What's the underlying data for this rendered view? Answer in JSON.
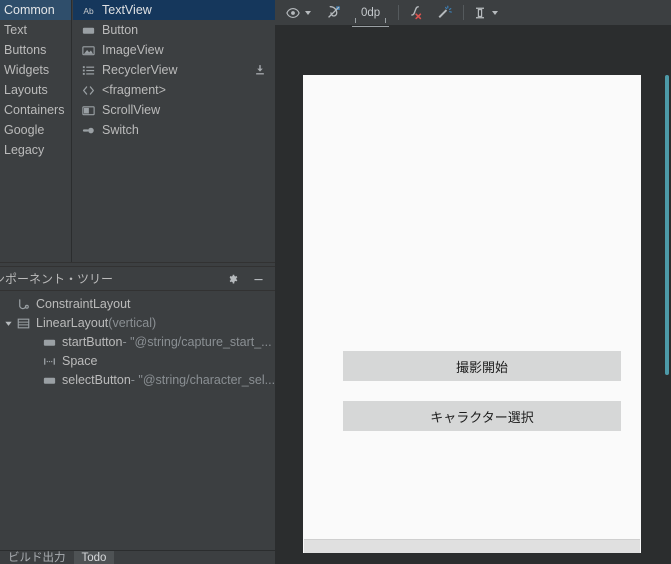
{
  "palette": {
    "categories": [
      {
        "label": "Common",
        "selected": true
      },
      {
        "label": "Text",
        "selected": false
      },
      {
        "label": "Buttons",
        "selected": false
      },
      {
        "label": "Widgets",
        "selected": false
      },
      {
        "label": "Layouts",
        "selected": false
      },
      {
        "label": "Containers",
        "selected": false
      },
      {
        "label": "Google",
        "selected": false
      },
      {
        "label": "Legacy",
        "selected": false
      }
    ],
    "items": [
      {
        "label": "TextView",
        "icon": "textview-icon",
        "selected": true,
        "download": false
      },
      {
        "label": "Button",
        "icon": "button-icon",
        "selected": false,
        "download": false
      },
      {
        "label": "ImageView",
        "icon": "imageview-icon",
        "selected": false,
        "download": false
      },
      {
        "label": "RecyclerView",
        "icon": "recyclerview-icon",
        "selected": false,
        "download": true
      },
      {
        "label": "<fragment>",
        "icon": "fragment-icon",
        "selected": false,
        "download": false
      },
      {
        "label": "ScrollView",
        "icon": "scrollview-icon",
        "selected": false,
        "download": false
      },
      {
        "label": "Switch",
        "icon": "switch-icon",
        "selected": false,
        "download": false
      }
    ]
  },
  "tree": {
    "title": "ンポーネント・ツリー",
    "settings_icon": "gear-icon",
    "minimize_icon": "minimize-icon",
    "rows": [
      {
        "indent": 0,
        "twisty": "",
        "icon": "constraintlayout-icon",
        "name": "ConstraintLayout",
        "suffix": ""
      },
      {
        "indent": 0,
        "twisty": "▼",
        "icon": "linearlayout-icon",
        "name": "LinearLayout",
        "suffix": "(vertical)"
      },
      {
        "indent": 1,
        "twisty": "",
        "icon": "button-icon",
        "name": "startButton",
        "suffix": "- \"@string/capture_start_..."
      },
      {
        "indent": 1,
        "twisty": "",
        "icon": "space-icon",
        "name": "Space",
        "suffix": ""
      },
      {
        "indent": 1,
        "twisty": "",
        "icon": "button-icon",
        "name": "selectButton",
        "suffix": "- \"@string/character_sel..."
      }
    ]
  },
  "bottom_tabs": [
    {
      "label": "ビルド出力",
      "active": false
    },
    {
      "label": "Todo",
      "active": true
    },
    {
      "label": "",
      "active": false
    }
  ],
  "toolbar": {
    "view_options_icon": "eye-icon",
    "autoconnect_icon": "autoconnect-off-icon",
    "default_margin": "0dp",
    "clear_constraints_icon": "clear-constraints-icon",
    "infer_constraints_icon": "magic-wand-icon",
    "align_icon": "vertical-align-icon"
  },
  "preview": {
    "buttons": [
      {
        "text": "撮影開始",
        "name": "start-button"
      },
      {
        "text": "キャラクター選択",
        "name": "select-button"
      }
    ]
  },
  "colors": {
    "panel_bg": "#3c3f41",
    "surface_bg": "#2b2d2e",
    "selection_blue": "#15375c",
    "category_selection": "#2f4e6b",
    "device_bg": "#fafafa",
    "device_button": "#d6d7d7",
    "scrollbar": "#4d9aa8"
  }
}
